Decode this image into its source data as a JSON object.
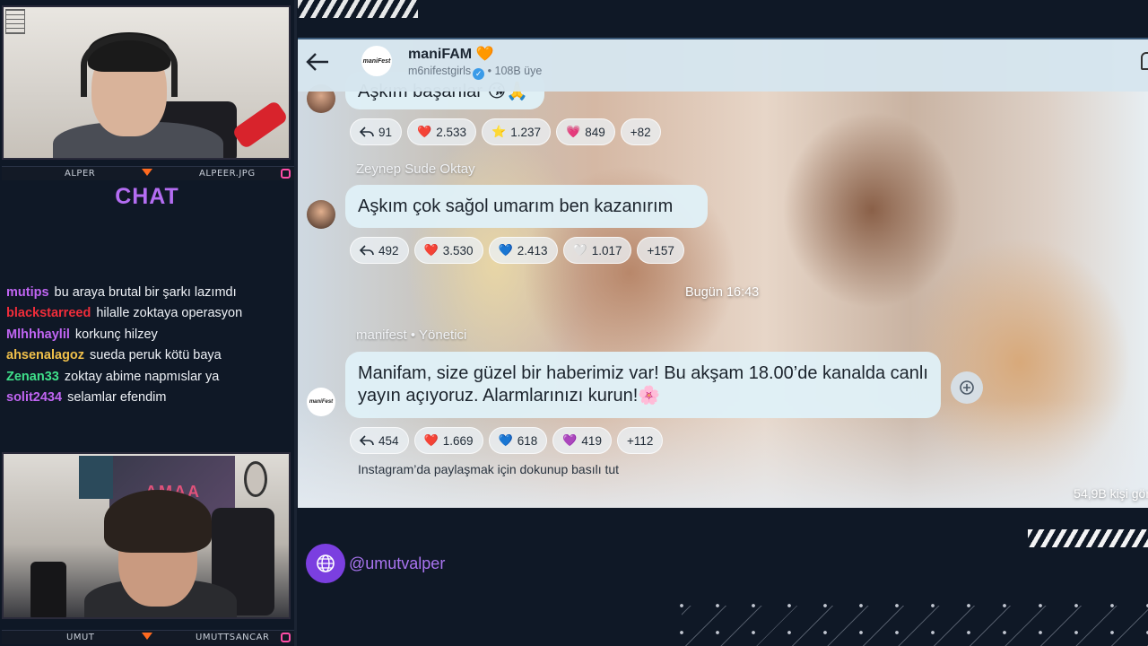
{
  "streamer": {
    "top_cam_name": "ALPER",
    "top_cam_handle": "ALPEER.JPG",
    "bottom_cam_name": "UMUT",
    "bottom_cam_handle": "UMUTTSANCAR",
    "chat_title": "CHAT",
    "social_handle": "@umutvalper"
  },
  "chat": [
    {
      "user": "mutips",
      "color": "#c065f2",
      "text": "bu araya brutal bir şarkı lazımdı"
    },
    {
      "user": "blackstarreed",
      "color": "#f02d3a",
      "text": "hilalle zoktaya operasyon"
    },
    {
      "user": "Mlhhhaylil",
      "color": "#c065f2",
      "text": "korkunç hilzey"
    },
    {
      "user": "ahsenalagoz",
      "color": "#f0c04a",
      "text": "sueda peruk kötü baya"
    },
    {
      "user": "Zenan33",
      "color": "#3fe08a",
      "text": "zoktay abime napmıslar ya"
    },
    {
      "user": "solit2434",
      "color": "#c065f2",
      "text": "selamlar efendim"
    }
  ],
  "channel": {
    "name": "maniFAM",
    "name_emoji": "🧡",
    "owner": "m6nifestgirls",
    "members": "• 108B üye",
    "avatar_text": "maniFest"
  },
  "messages": [
    {
      "text": "Aşkım başarılar",
      "reactions": [
        {
          "icon": "reply",
          "count": "91"
        },
        {
          "icon": "❤️",
          "count": "2.533"
        },
        {
          "icon": "⭐",
          "count": "1.237"
        },
        {
          "icon": "💗",
          "count": "849"
        },
        {
          "icon": "",
          "count": "+82"
        }
      ]
    },
    {
      "sender": "Zeynep Sude Oktay",
      "text": "Aşkım çok sağol umarım ben kazanırım",
      "reactions": [
        {
          "icon": "reply",
          "count": "492"
        },
        {
          "icon": "❤️",
          "count": "3.530"
        },
        {
          "icon": "💙",
          "count": "2.413"
        },
        {
          "icon": "🤍",
          "count": "1.017"
        },
        {
          "icon": "",
          "count": "+157"
        }
      ]
    },
    {
      "sender": "manifest • Yönetici",
      "text": "Manifam, size güzel bir haberimiz var! Bu akşam 18.00’de kanalda canlı yayın açıyoruz. Alarmlarınızı kurun!🌸",
      "reactions": [
        {
          "icon": "reply",
          "count": "454"
        },
        {
          "icon": "❤️",
          "count": "1.669"
        },
        {
          "icon": "💙",
          "count": "618"
        },
        {
          "icon": "💜",
          "count": "419"
        },
        {
          "icon": "",
          "count": "+112"
        }
      ]
    }
  ],
  "date_separator": "Bugün 16:43",
  "hint": "Instagram’da paylaşmak için dokunup basılı tut",
  "views": "54,9B kişi gör"
}
